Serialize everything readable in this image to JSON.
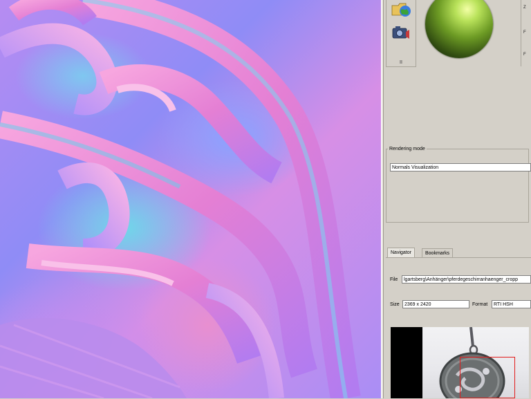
{
  "viewport": {
    "description_icon": "normals-visualization-canvas"
  },
  "toolbar": {
    "tools": [
      {
        "icon": "folder-globe-icon"
      },
      {
        "icon": "camera-icon"
      }
    ],
    "mode_label": "II"
  },
  "light_control": {
    "icon": "light-sphere-icon"
  },
  "rendering": {
    "legend": "Rendering mode",
    "selected": "Normals Visualization"
  },
  "tabs": [
    "Navigator",
    "Bookmarks"
  ],
  "navigator": {
    "file_label": "File",
    "file_value": "lgartsberg\\Anhänger\\pferdegeschirranhaenger_cropp",
    "size_label": "Size",
    "size_value": "2369 x 2420",
    "format_label": "Format",
    "format_value": "RTI HSH"
  },
  "colors": {
    "panel_bg": "#d4d0c8",
    "selection_rect": "#e21b1b"
  }
}
